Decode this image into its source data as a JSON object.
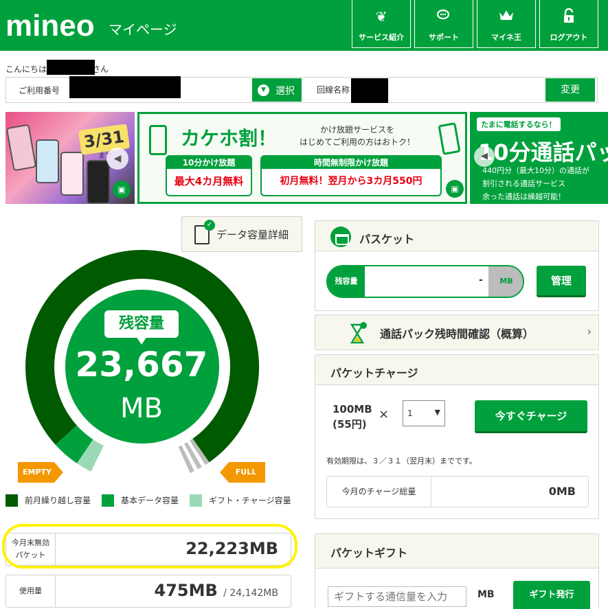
{
  "header": {
    "logo": "mineo",
    "page_name": "マイページ",
    "buttons": [
      {
        "label": "サービス紹介",
        "icon": "heart-leaf-icon"
      },
      {
        "label": "サポート",
        "icon": "chat-bubbles-icon"
      },
      {
        "label": "マイネ王",
        "icon": "crown-icon"
      },
      {
        "label": "ログアウト",
        "icon": "lock-icon"
      }
    ]
  },
  "greeting": {
    "prefix": "こんにちは",
    "suffix": "さん"
  },
  "account": {
    "number_label": "ご利用番号",
    "select_label": "選択",
    "line_name_label": "回線名称",
    "change_label": "変更"
  },
  "banners": {
    "b1": {
      "date": "3/31",
      "until": "まで"
    },
    "b2": {
      "title": "カケホ割！",
      "sub": "かけ放題サービスを\nはじめてご利用の方はおトク！",
      "box1_head": "10分かけ放題",
      "box1_body": "最大4カ月無料",
      "box2_head": "時間無制限かけ放題",
      "box2_body": "初月無料！翌月から3カ月550円"
    },
    "b3": {
      "tag": "たまに電話するなら！",
      "big": "10分通話パッ",
      "lines": [
        "440円分（最大10分）の通話が",
        "割引される通話サービス",
        "余った通話は繰越可能！"
      ]
    }
  },
  "data_detail_label": "データ容量詳細",
  "gauge": {
    "bubble": "残容量",
    "value": "23,667",
    "unit": "MB",
    "empty_label": "EMPTY",
    "full_label": "FULL",
    "colors": {
      "carryover": "#005a00",
      "basic": "#00a03c",
      "gift": "#9bd9b6",
      "ring_bg": "#ffffff"
    }
  },
  "legend": [
    {
      "label": "前月繰り越し容量",
      "color": "#005a00"
    },
    {
      "label": "基本データ容量",
      "color": "#00a03c"
    },
    {
      "label": "ギフト・チャージ容量",
      "color": "#9bd9b6"
    }
  ],
  "usage": {
    "expiring_label": "今月末無効\nパケット",
    "expiring_value": "22,223MB",
    "used_label": "使用量",
    "used_value": "475MB",
    "used_total": "/ 24,142MB"
  },
  "basket": {
    "title": "パスケット",
    "remain_label": "残容量",
    "remain_value": "-",
    "remain_unit": "MB",
    "manage_label": "管理"
  },
  "call_pack": {
    "label": "通話パック残時間確認（概算）",
    "chevron": "›"
  },
  "charge": {
    "title": "パケットチャージ",
    "amount": "100MB\n(55円)",
    "times": "×",
    "qty": "1",
    "button": "今すぐチャージ",
    "note": "有効期限は、３／３１（翌月末）までです。",
    "total_label": "今月のチャージ総量",
    "total_value": "0MB"
  },
  "gift": {
    "title": "パケットギフト",
    "input_placeholder": "ギフトする通信量を入力",
    "unit": "MB",
    "button": "ギフト発行"
  }
}
